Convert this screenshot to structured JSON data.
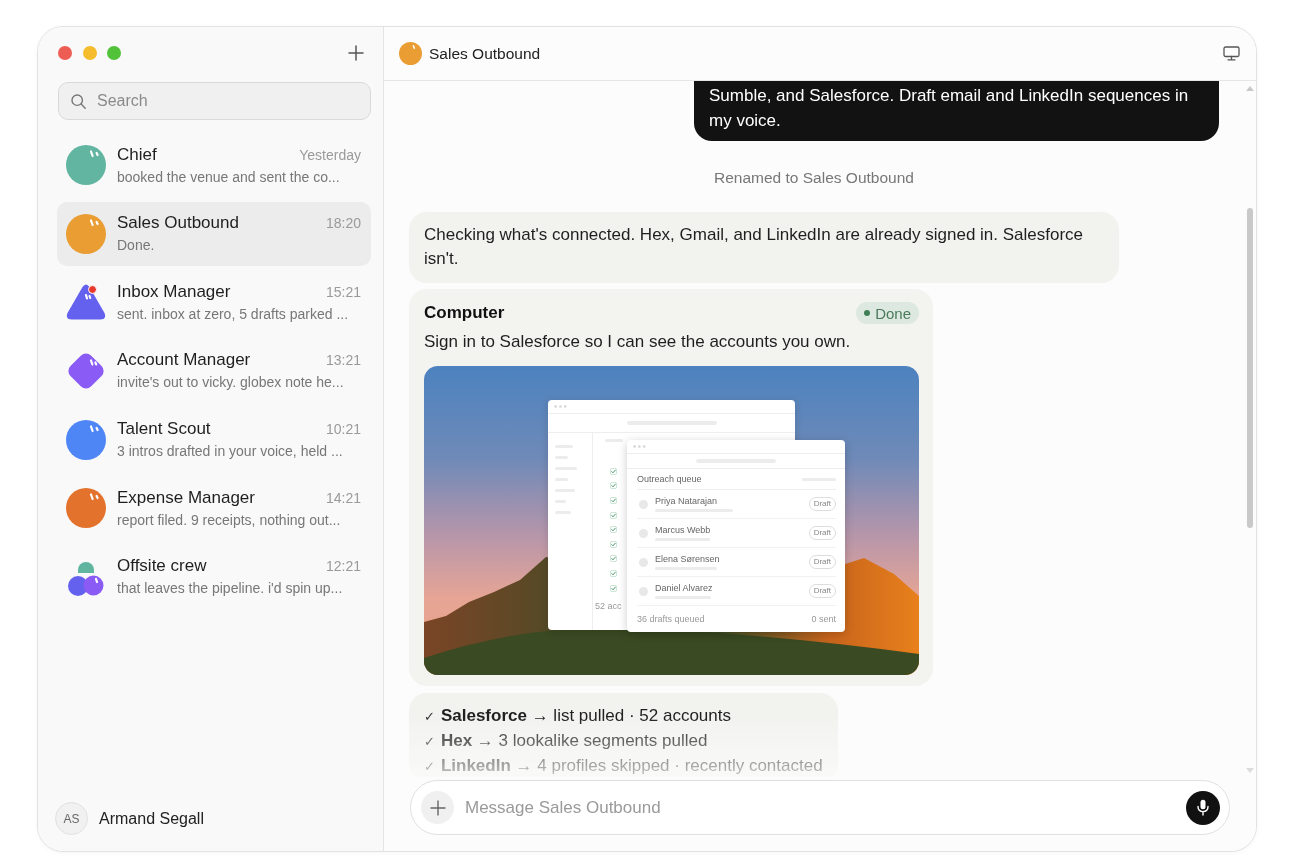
{
  "sidebar": {
    "search": {
      "placeholder": "Search"
    },
    "items": [
      {
        "name": "Chief",
        "time": "Yesterday",
        "preview": "booked the venue and sent the co...",
        "kind": "circle",
        "color": "#62b5a0",
        "unread": false,
        "selected": false
      },
      {
        "name": "Sales Outbound",
        "time": "18:20",
        "preview": "Done.",
        "kind": "circle",
        "color": "#e99d33",
        "unread": false,
        "selected": true
      },
      {
        "name": "Inbox Manager",
        "time": "15:21",
        "preview": "sent. inbox at zero, 5 drafts parked ...",
        "kind": "triangle",
        "color": "#6461ef",
        "unread": true,
        "selected": false
      },
      {
        "name": "Account Manager",
        "time": "13:21",
        "preview": "invite's out to vicky. globex note he...",
        "kind": "diamond",
        "color": "#8a5cf5",
        "unread": false,
        "selected": false
      },
      {
        "name": "Talent Scout",
        "time": "10:21",
        "preview": "3 intros drafted in your voice, held ...",
        "kind": "circle",
        "color": "#4e86f6",
        "unread": false,
        "selected": false
      },
      {
        "name": "Expense Manager",
        "time": "14:21",
        "preview": "report filed. 9 receipts, nothing out...",
        "kind": "circle",
        "color": "#e3722c",
        "unread": false,
        "selected": false
      },
      {
        "name": "Offsite crew",
        "time": "12:21",
        "preview": "that leaves the pipeline. i'd spin up...",
        "kind": "group",
        "color": "#8a5cf5",
        "unread": false,
        "selected": false
      }
    ],
    "user": {
      "initials": "AS",
      "name": "Armand Segall"
    }
  },
  "chat": {
    "title": "Sales Outbound",
    "messages": [
      {
        "kind": "user",
        "text": "Sumble, and Salesforce. Draft email and LinkedIn sequences in my voice."
      },
      {
        "kind": "event",
        "text": "Renamed to Sales Outbound"
      },
      {
        "kind": "assistant",
        "text": "Checking what's connected. Hex, Gmail, and LinkedIn are already signed in. Salesforce isn't."
      },
      {
        "kind": "tool",
        "title": "Computer",
        "status": "Done",
        "text": "Sign in to Salesforce so I can see the accounts you own.",
        "screenshot": {
          "back_window": {
            "rows": [
              {
                "checked": true
              },
              {
                "checked": true
              },
              {
                "checked": true
              },
              {
                "checked": true
              },
              {
                "checked": true
              },
              {
                "checked": true
              },
              {
                "checked": true
              },
              {
                "checked": true
              },
              {
                "checked": true
              }
            ],
            "footer": "52 acc"
          },
          "front_window": {
            "title": "Outreach queue",
            "rows": [
              {
                "name": "Priya Natarajan",
                "status": "Draft"
              },
              {
                "name": "Marcus Webb",
                "status": "Draft"
              },
              {
                "name": "Elena Sørensen",
                "status": "Draft"
              },
              {
                "name": "Daniel Alvarez",
                "status": "Draft"
              }
            ],
            "footer_left": "36 drafts queued",
            "footer_right": "0 sent"
          }
        }
      },
      {
        "kind": "checklist",
        "items": [
          {
            "check": "✓",
            "text": "**Salesforce** → list pulled · 52 accounts"
          },
          {
            "check": "✓",
            "text": "**Hex** → 3 lookalike segments pulled"
          },
          {
            "check": "✓",
            "text": "**LinkedIn** → 4 profiles skipped · recently contacted"
          }
        ]
      }
    ],
    "composer": {
      "placeholder": "Message Sales Outbound"
    }
  }
}
